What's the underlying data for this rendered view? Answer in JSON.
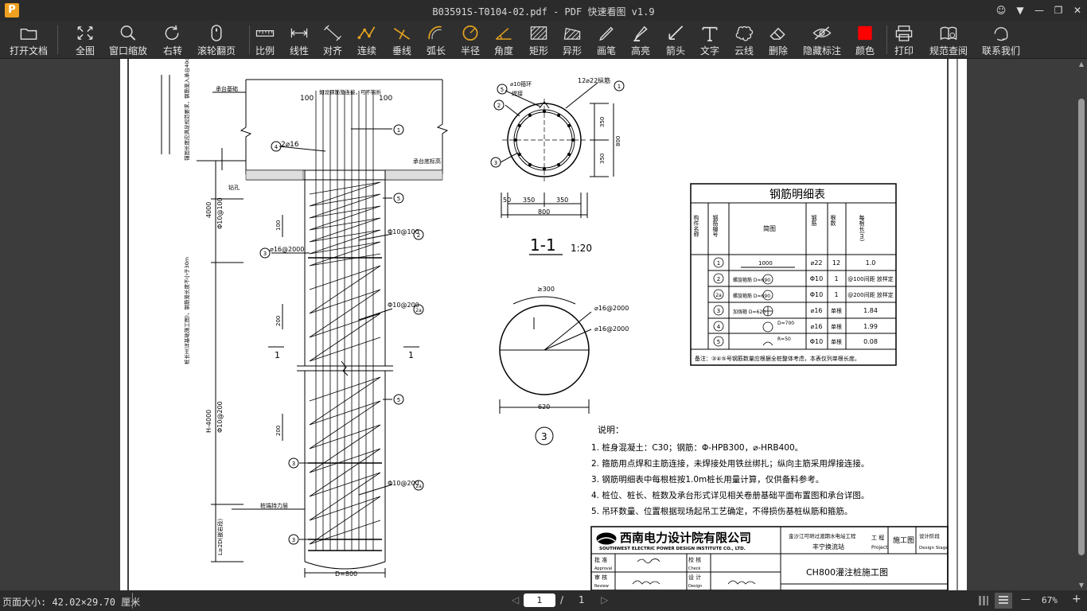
{
  "window": {
    "app_icon": "P",
    "title": "B03591S-T0104-02.pdf - PDF 快速看图 v1.9",
    "controls": [
      {
        "name": "user-icon",
        "glyph": "☺"
      },
      {
        "name": "dropdown-icon",
        "glyph": "▼"
      },
      {
        "name": "minimize-icon",
        "glyph": "—"
      },
      {
        "name": "restore-icon",
        "glyph": "❐"
      },
      {
        "name": "close-icon",
        "glyph": "✕"
      }
    ]
  },
  "toolbar": {
    "tools": [
      {
        "id": "open",
        "label": "打开文档",
        "icon": "folder-icon"
      },
      {
        "id": "fit",
        "label": "全图",
        "icon": "fit-all-icon"
      },
      {
        "id": "zoom",
        "label": "窗口缩放",
        "icon": "zoom-icon"
      },
      {
        "id": "rotate",
        "label": "右转",
        "icon": "rotate-icon"
      },
      {
        "id": "scroll",
        "label": "滚轮翻页",
        "icon": "mouse-icon"
      },
      {
        "id": "scale",
        "label": "比例",
        "icon": "ruler-icon"
      },
      {
        "id": "linear",
        "label": "线性",
        "icon": "linear-dim-icon"
      },
      {
        "id": "align",
        "label": "对齐",
        "icon": "aligned-dim-icon"
      },
      {
        "id": "continuous",
        "label": "连续",
        "icon": "polyline-icon"
      },
      {
        "id": "perp",
        "label": "垂线",
        "icon": "perpendicular-icon"
      },
      {
        "id": "arc",
        "label": "弧长",
        "icon": "arc-length-icon"
      },
      {
        "id": "radius",
        "label": "半径",
        "icon": "radius-icon"
      },
      {
        "id": "angle",
        "label": "角度",
        "icon": "angle-icon"
      },
      {
        "id": "rect",
        "label": "矩形",
        "icon": "rectangle-area-icon"
      },
      {
        "id": "irregular",
        "label": "异形",
        "icon": "irregular-area-icon"
      },
      {
        "id": "pen",
        "label": "画笔",
        "icon": "pen-icon"
      },
      {
        "id": "highlight",
        "label": "高亮",
        "icon": "highlighter-icon"
      },
      {
        "id": "arrow",
        "label": "箭头",
        "icon": "arrow-icon"
      },
      {
        "id": "text",
        "label": "文字",
        "icon": "text-icon"
      },
      {
        "id": "cloud",
        "label": "云线",
        "icon": "cloud-icon"
      },
      {
        "id": "delete",
        "label": "删除",
        "icon": "eraser-icon"
      },
      {
        "id": "hide",
        "label": "隐藏标注",
        "icon": "eye-hidden-icon"
      },
      {
        "id": "color",
        "label": "颜色",
        "icon": "color-swatch-icon",
        "color": "#ff0000"
      },
      {
        "id": "print",
        "label": "打印",
        "icon": "printer-icon"
      },
      {
        "id": "standard",
        "label": "规范查阅",
        "icon": "book-icon"
      },
      {
        "id": "contact",
        "label": "联系我们",
        "icon": "support-icon"
      }
    ]
  },
  "drawing": {
    "elev_notes": {
      "top_slab": "承台基础",
      "lap_top": "如设钢筋笼连接，可不钩折",
      "dim_100": "100",
      "dim_100b": "100",
      "n4_label": "2⌀16",
      "ground": "承台底标高",
      "bottom_note": "钻孔",
      "d4000": "4000",
      "phi10_100": "Φ10@100",
      "phi10_200": "Φ10@200",
      "h4000": "H-4000",
      "l_bot": "L≥2D(嵌岩段)",
      "ld_100": "100",
      "ld_200": "200",
      "ld_200b": "200",
      "r_phi10_100": "Φ10@100",
      "r_phi10_200": "Φ10@200",
      "r_phi10_200b": "Φ10@200",
      "r_16_2000": "⌀16@2000",
      "section_1": "1",
      "section_1b": "1",
      "d800": "D=800",
      "pile_bearing": "桩端持力层",
      "side_note_1": "桩长H(详基础施工图)，钢筋笼长度不小于30m",
      "side_note_2": "锚固长度应满足规范要求，钢筋笼入承台40d",
      "callouts": [
        "1",
        "2",
        "2a",
        "3",
        "4",
        "5"
      ]
    },
    "section11": {
      "top_left": "⌀10箍环",
      "weld": "焊接",
      "main_bar": "12⌀22纵筋",
      "dim_350": "350",
      "dim_350b": "350",
      "dim_800": "800",
      "dim_50": "50",
      "dim_800b": "800",
      "title": "1-1",
      "scale": "1:20"
    },
    "detail3": {
      "lap": "≥300",
      "r1": "⌀16@2000",
      "r2": "⌀16@2000",
      "d620": "620",
      "num": "3"
    },
    "rebar_table": {
      "title": "钢筋明细表",
      "headers": [
        "构件名称",
        "钢筋编号",
        "简图",
        "钢筋",
        "根数",
        "每根长(m)"
      ],
      "rows": [
        {
          "no": "1",
          "sketch": "1000",
          "bar": "⌀22",
          "count": "12",
          "len": "1.0"
        },
        {
          "no": "2",
          "sketch": "螺旋箍筋 D=690",
          "bar": "Φ10",
          "count": "1",
          "len": "@100间距 放样定"
        },
        {
          "no": "2a",
          "sketch": "螺旋箍筋 D=690",
          "bar": "Φ10",
          "count": "1",
          "len": "@200间距 放样定"
        },
        {
          "no": "3",
          "sketch": "加强箍 D=620",
          "bar": "⌀16",
          "count": "单根",
          "len": "1.84"
        },
        {
          "no": "4",
          "sketch": "D=700",
          "bar": "⌀16",
          "count": "单根",
          "len": "1.99"
        },
        {
          "no": "5",
          "sketch": "R=50",
          "bar": "Φ10",
          "count": "单根",
          "len": "0.08"
        }
      ],
      "note": "备注：③④⑤号钢筋数量应根据全桩整体考虑，本表仅列单根长度。"
    },
    "notes": {
      "title": "说明：",
      "items": [
        "1. 桩身混凝土：C30；钢筋：Φ-HPB300，⌀-HRB400。",
        "2. 箍筋用点焊和主筋连接，未焊接处用铁丝绑扎；纵向主筋采用焊接连接。",
        "3. 钢筋明细表中每根桩按1.0m桩长用量计算，仅供备料参考。",
        "4. 桩位、桩长、桩数及承台形式详见相关卷册基础平面布置图和承台详图。",
        "5. 吊环数量、位置根据现场起吊工艺确定，不得损伤基桩纵筋和箍筋。"
      ]
    },
    "titleblock": {
      "company": "西南电力设计院有限公司",
      "company_en": "SOUTHWEST ELECTRIC POWER DESIGN INSTITUTE CO., LTD.",
      "project": "金沙江可研过渡期水电站工程",
      "station": "丰宁换流站",
      "proj_label": "工 程",
      "proj_en": "Project",
      "stage": "施工图",
      "stage_label": "设计阶段",
      "stage_en": "Design Stage",
      "approve": "批 准",
      "approve_en": "Approval",
      "check": "校 核",
      "check_en": "Check",
      "review": "审 核",
      "review_en": "Review",
      "design": "设 计",
      "design_en": "Design",
      "drawing_title": "CH800灌注桩施工图"
    }
  },
  "status": {
    "page_size": "页面大小: 42.02×29.70 厘米",
    "page_current": "1",
    "slash": "/",
    "page_total": "1",
    "zoom": "67%",
    "zoom_minus": "—",
    "zoom_plus": "+"
  }
}
